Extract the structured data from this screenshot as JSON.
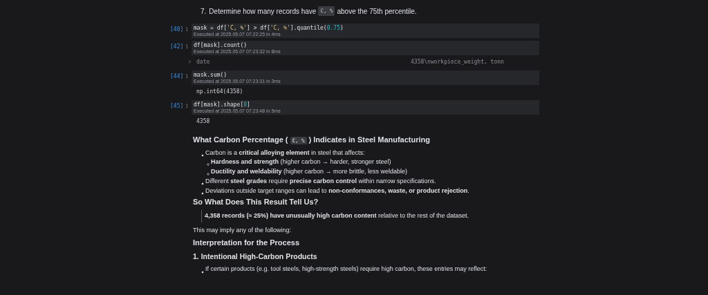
{
  "step": {
    "number": "7.",
    "segments": [
      {
        "kind": "text",
        "text": "Determine how many records have"
      },
      {
        "kind": "code",
        "text": "C, %"
      },
      {
        "kind": "text",
        "text": "above the 75th percentile."
      }
    ]
  },
  "cells": [
    {
      "prompt": "[40]",
      "line_number": "1",
      "tokens": [
        {
          "kind": "plain",
          "text": "mask = df["
        },
        {
          "kind": "string",
          "text": "'C, %'"
        },
        {
          "kind": "plain",
          "text": "] > df["
        },
        {
          "kind": "string",
          "text": "'C, %'"
        },
        {
          "kind": "plain",
          "text": "].quantile("
        },
        {
          "kind": "number",
          "text": "0.75"
        },
        {
          "kind": "plain",
          "text": ")"
        }
      ],
      "executed": "Executed at 2025.05.07 07:22:25 in 4ms"
    },
    {
      "prompt": "[42]",
      "line_number": "1",
      "tokens": [
        {
          "kind": "plain",
          "text": "df[mask].count()"
        }
      ],
      "executed": "Executed at 2025.05.07 07:23:32 in 8ms",
      "output": {
        "kind": "series",
        "toggle": "›",
        "index": "date",
        "value": "4358\\nworkpiece_weight, tonn"
      }
    },
    {
      "prompt": "[44]",
      "line_number": "1",
      "tokens": [
        {
          "kind": "plain",
          "text": "mask.sum()"
        }
      ],
      "executed": "Executed at 2025.05.07 07:23:31 in 3ms",
      "output": {
        "kind": "text",
        "text": "np.int64(4358)"
      }
    },
    {
      "prompt": "[45]",
      "line_number": "1",
      "tokens": [
        {
          "kind": "plain",
          "text": "df[mask].shape["
        },
        {
          "kind": "number",
          "text": "0"
        },
        {
          "kind": "plain",
          "text": "]"
        }
      ],
      "executed": "Executed at 2025.05.07 07:23:48 in 5ms",
      "output": {
        "kind": "text",
        "text": "4358"
      }
    }
  ],
  "markdown": [
    {
      "kind": "heading",
      "segments": [
        {
          "kind": "text",
          "text": "What Carbon Percentage ("
        },
        {
          "kind": "code",
          "text": "C, %"
        },
        {
          "kind": "text",
          "text": ") Indicates in Steel Manufacturing"
        }
      ]
    },
    {
      "kind": "bullets",
      "items": [
        {
          "text": "Carbon is a **critical alloying element** in steel that affects:",
          "children": [
            {
              "text": "**Hardness and strength** (higher carbon → harder, stronger steel)"
            },
            {
              "text": "**Ductility and weldability** (higher carbon → more brittle, less weldable)"
            }
          ]
        },
        {
          "text": "Different **steel grades** require **precise carbon control** within narrow specifications."
        },
        {
          "text": "Deviations outside target ranges can lead to **non-conformances, waste, or product rejection**."
        }
      ]
    },
    {
      "kind": "heading",
      "segments": [
        {
          "kind": "text",
          "text": "So What Does This Result Tell Us?"
        }
      ]
    },
    {
      "kind": "quote",
      "text": "**4,358 records (≈ 25%) have unusually high carbon content** relative to the rest of the dataset."
    },
    {
      "kind": "paragraph",
      "text": "This may imply any of the following:"
    },
    {
      "kind": "heading",
      "segments": [
        {
          "kind": "text",
          "text": "Interpretation for the Process"
        }
      ]
    },
    {
      "kind": "subheading",
      "segments": [
        {
          "kind": "text",
          "text": "1. Intentional High-Carbon Products"
        }
      ]
    },
    {
      "kind": "bullets",
      "items": [
        {
          "text": "If certain products (e.g. tool steels, high-strength steels) require high carbon, these entries may reflect:"
        }
      ]
    }
  ]
}
